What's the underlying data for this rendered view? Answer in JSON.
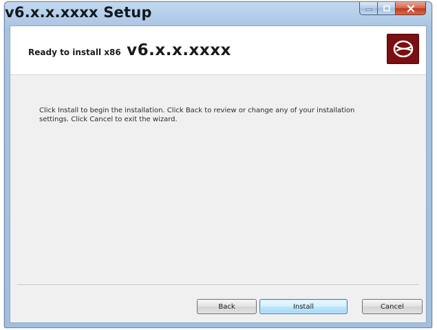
{
  "window": {
    "title": "v6.x.x.xxxx Setup",
    "caption_buttons": [
      "minimize-icon",
      "maximize-icon",
      "close-icon"
    ]
  },
  "banner": {
    "prefix": "Ready to install x86",
    "version": "v6.x.x.xxxx",
    "logo_icon": "brand-logo-icon"
  },
  "message": "Click Install to begin the installation. Click Back to review or change any of your installation settings. Click Cancel to exit the wizard.",
  "buttons": {
    "back": "Back",
    "install": "Install",
    "cancel": "Cancel"
  },
  "colors": {
    "logo_background": "#7b0f12",
    "install_button_border": "#3c7fb1",
    "close_button": "#c13a1f"
  }
}
